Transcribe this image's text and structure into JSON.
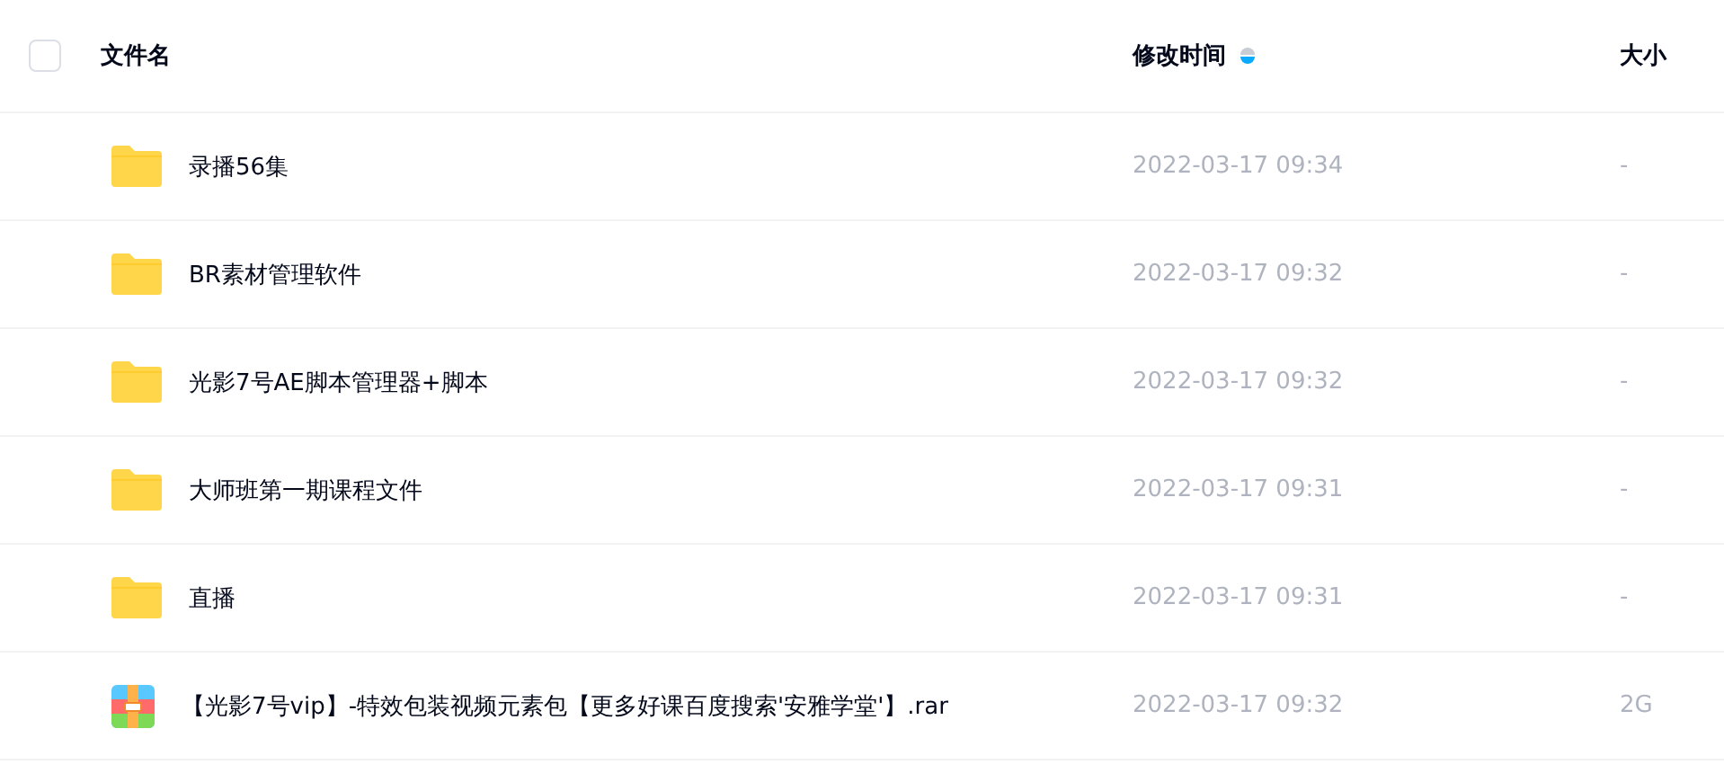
{
  "header": {
    "select_all": {
      "checked": false
    },
    "columns": [
      {
        "label": "文件名"
      },
      {
        "label": "修改时间",
        "sorted": true,
        "descending": true
      },
      {
        "label": "大小"
      }
    ]
  },
  "rows": [
    {
      "kind": "folder",
      "name": "录播56集",
      "modified": "2022-03-17 09:34",
      "size": "-"
    },
    {
      "kind": "folder",
      "name": "BR素材管理软件",
      "modified": "2022-03-17 09:32",
      "size": "-"
    },
    {
      "kind": "folder",
      "name": "光影7号AE脚本管理器+脚本",
      "modified": "2022-03-17 09:32",
      "size": "-"
    },
    {
      "kind": "folder",
      "name": "大师班第一期课程文件",
      "modified": "2022-03-17 09:31",
      "size": "-"
    },
    {
      "kind": "folder",
      "name": "直播",
      "modified": "2022-03-17 09:31",
      "size": "-"
    },
    {
      "kind": "archive",
      "name": "【光影7号vip】-特效包装视频元素包【更多好课百度搜索'安雅学堂'】.rar",
      "modified": "2022-03-17 09:32",
      "size": "2G"
    }
  ]
}
